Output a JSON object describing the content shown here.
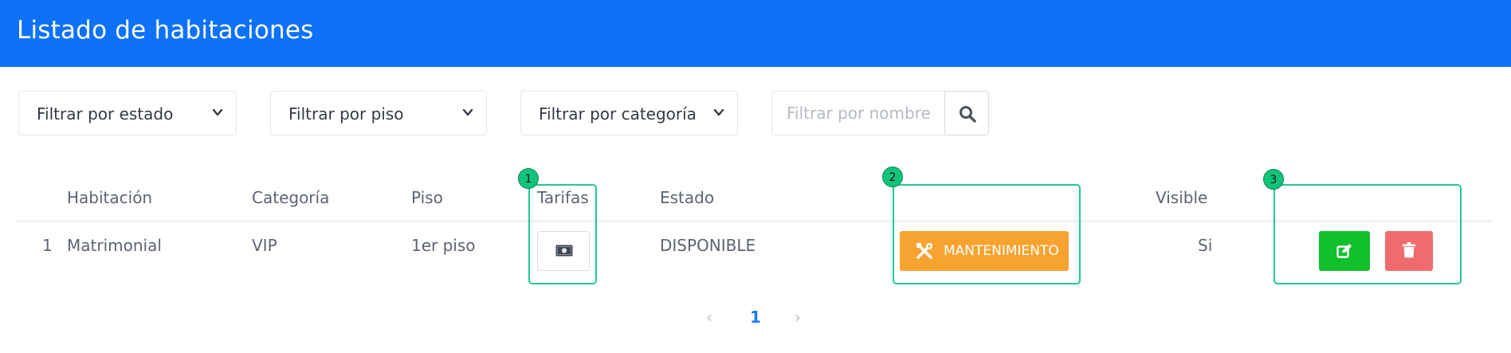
{
  "header": {
    "title": "Listado de habitaciones"
  },
  "filters": {
    "estado": "Filtrar por estado",
    "piso": "Filtrar por piso",
    "categoria": "Filtrar por categoría",
    "nombre_placeholder": "Filtrar por nombre"
  },
  "table": {
    "headers": {
      "num": "",
      "habitacion": "Habitación",
      "categoria": "Categoría",
      "piso": "Piso",
      "tarifas": "Tarifas",
      "estado": "Estado",
      "visible": "Visible"
    },
    "rows": [
      {
        "num": "1",
        "habitacion": "Matrimonial",
        "categoria": "VIP",
        "piso": "1er piso",
        "estado": "DISPONIBLE",
        "action_label": "MANTENIMIENTO",
        "visible": "Si"
      }
    ]
  },
  "annotations": [
    "1",
    "2",
    "3"
  ],
  "pagination": {
    "prev": "‹",
    "current": "1",
    "next": "›"
  },
  "colors": {
    "header_bg": "#0d72f7",
    "maintenance": "#f7a330",
    "edit": "#10c02c",
    "delete": "#f06c6c",
    "highlight": "#22c98f",
    "pagination_active": "#1d7bf5"
  },
  "icons": [
    "search-icon",
    "money-icon",
    "tools-icon",
    "edit-icon",
    "trash-icon",
    "chevron-down-icon"
  ]
}
